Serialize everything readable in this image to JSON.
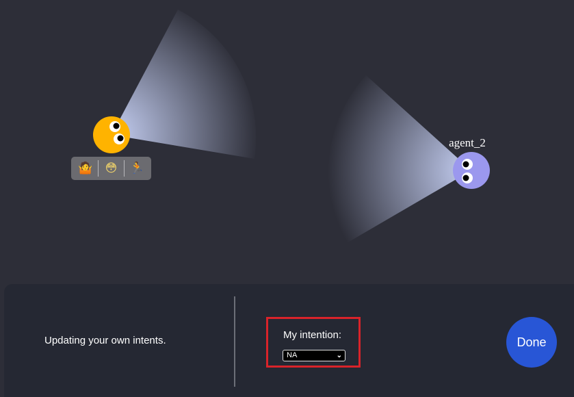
{
  "agents": [
    {
      "name": "",
      "color": "#ffb300",
      "facing": "right-up",
      "icon": "agent-1-avatar"
    },
    {
      "name": "agent_2",
      "color": "#9b98ee",
      "facing": "left",
      "icon": "agent-2-avatar"
    }
  ],
  "emoji_bar": {
    "items": [
      {
        "icon": "person-shrugging-icon",
        "glyph": "🤷"
      },
      {
        "icon": "flushed-face-icon",
        "glyph": "😳"
      },
      {
        "icon": "person-running-icon",
        "glyph": "🏃"
      }
    ]
  },
  "panel": {
    "status_text": "Updating your own intents.",
    "intention_label": "My intention:",
    "intention_value": "NA",
    "done_label": "Done"
  },
  "colors": {
    "background": "#2d2e38",
    "panel": "#252833",
    "highlight": "#d9232a",
    "done_button": "#2856d6",
    "vision_cone": "#c3cdf2"
  }
}
